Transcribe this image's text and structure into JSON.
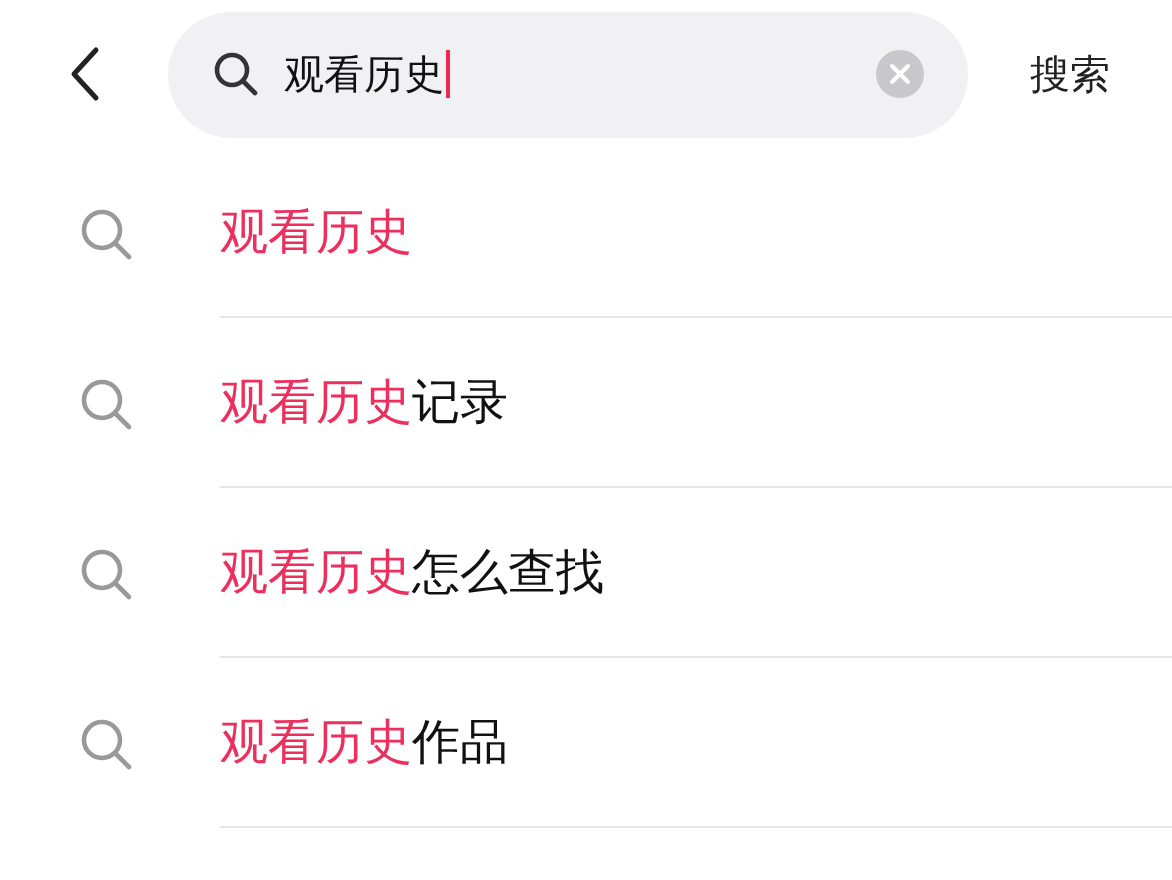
{
  "search": {
    "value": "观看历史",
    "button": "搜索"
  },
  "suggestions": [
    {
      "match": "观看历史"
    },
    {
      "match": "观看历史",
      "rest": "记录"
    },
    {
      "match": "观看历史",
      "rest": "怎么查找"
    },
    {
      "match": "观看历史",
      "rest": "作品"
    }
  ]
}
